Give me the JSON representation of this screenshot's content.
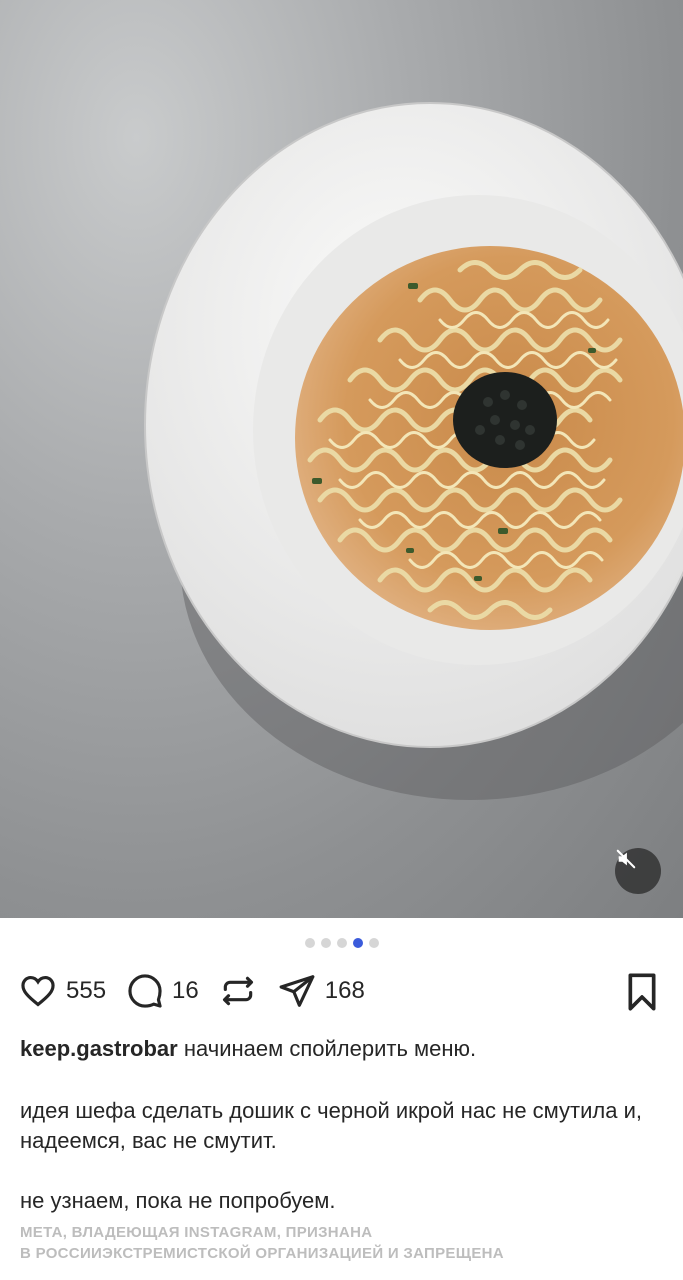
{
  "post": {
    "image_alt": "",
    "carousel": {
      "count": 5,
      "active_index": 3
    },
    "mute_icon": "speaker-muted-icon"
  },
  "actions": {
    "like_count": "555",
    "comment_count": "16",
    "share_count": "168",
    "icons": [
      "heart-icon",
      "comment-icon",
      "repost-icon",
      "send-icon",
      "bookmark-icon"
    ]
  },
  "caption": {
    "username": "keep.gastrobar",
    "line1": " начинаем спойлерить меню.",
    "line2": "идея шефа сделать дошик с черной икрой нас не смутила и, надеемся, вас не смутит.",
    "line3": "не узнаем, пока не попробуем."
  },
  "disclaimer": {
    "line1": "Мета, владеющая Instagram, признана",
    "line2": "в россииэкстремистской организацией и запрещена"
  },
  "colors": {
    "accent_dot": "#3b5bdb",
    "disclaimer": "#bdbdbd",
    "text": "#262626"
  }
}
